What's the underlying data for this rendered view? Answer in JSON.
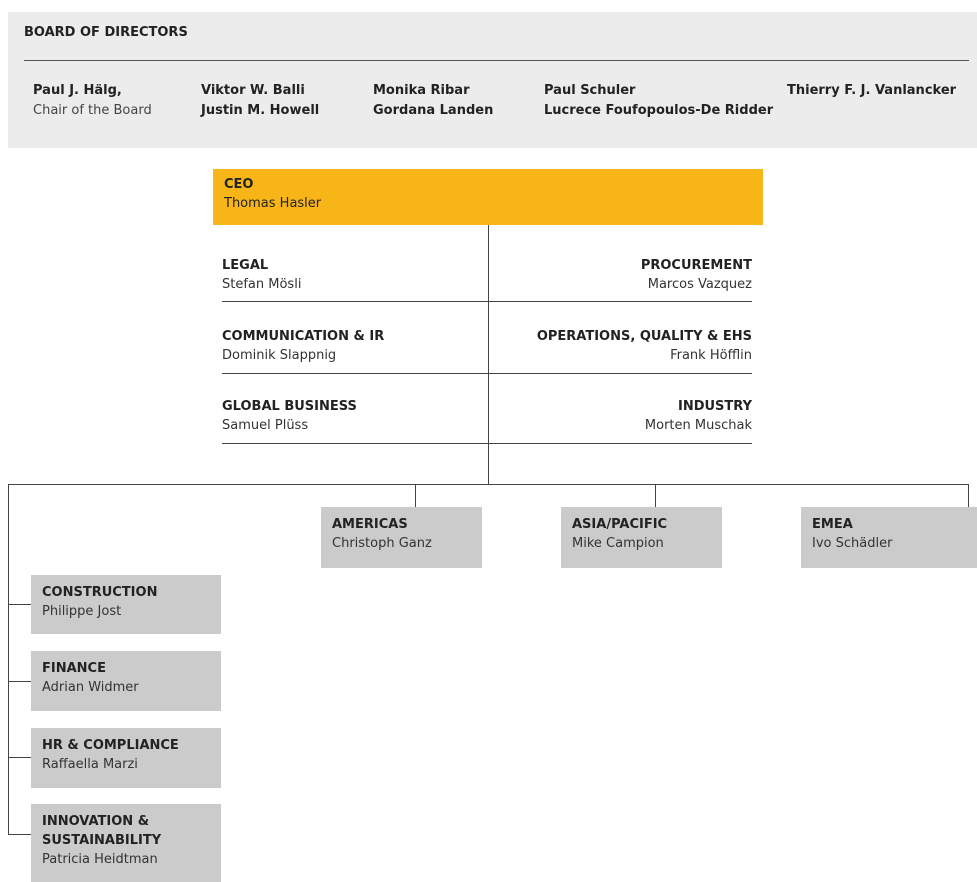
{
  "board": {
    "title": "BOARD OF DIRECTORS",
    "chair_name": "Paul J. Hälg,",
    "chair_role": "Chair of the Board",
    "members": [
      "Viktor W. Balli",
      "Justin M. Howell",
      "Monika Ribar",
      "Gordana Landen",
      "Paul Schuler",
      "Lucrece Foufopoulos-De Ridder",
      "Thierry F. J. Vanlancker"
    ]
  },
  "ceo": {
    "title": "CEO",
    "name": "Thomas Hasler"
  },
  "functions_left": [
    {
      "title": "LEGAL",
      "name": "Stefan Mösli"
    },
    {
      "title": "COMMUNICATION & IR",
      "name": "Dominik Slappnig"
    },
    {
      "title": "GLOBAL BUSINESS",
      "name": "Samuel Plüss"
    }
  ],
  "functions_right": [
    {
      "title": "PROCUREMENT",
      "name": "Marcos Vazquez"
    },
    {
      "title": "OPERATIONS, QUALITY & EHS",
      "name": "Frank Höfflin"
    },
    {
      "title": "INDUSTRY",
      "name": "Morten Muschak"
    }
  ],
  "regions": [
    {
      "title": "AMERICAS",
      "name": "Christoph Ganz"
    },
    {
      "title": "ASIA/PACIFIC",
      "name": "Mike Campion"
    },
    {
      "title": "EMEA",
      "name": "Ivo Schädler"
    }
  ],
  "divisions": [
    {
      "title": "CONSTRUCTION",
      "name": "Philippe Jost"
    },
    {
      "title": "FINANCE",
      "name": "Adrian Widmer"
    },
    {
      "title": "HR & COMPLIANCE",
      "name": "Raffaella Marzi"
    },
    {
      "title_line1": "INNOVATION &",
      "title_line2": "SUSTAINABILITY",
      "name": "Patricia Heidtman"
    }
  ]
}
